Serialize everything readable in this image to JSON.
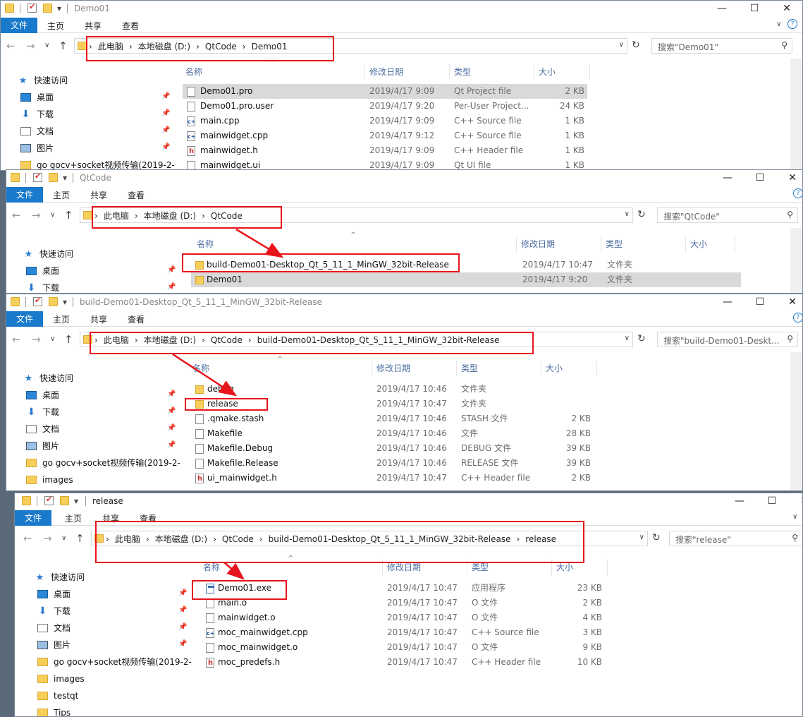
{
  "ribbon": {
    "file": "文件",
    "home": "主页",
    "share": "共享",
    "view": "查看",
    "help": "?"
  },
  "sidebar_common": {
    "quick_access": "快速访问",
    "desktop": "桌面",
    "downloads": "下载",
    "documents": "文档",
    "pictures": "图片",
    "gocv": "go gocv+socket视频传输(2019-2-",
    "images": "images",
    "testqt": "testqt",
    "tips": "Tips"
  },
  "columns": {
    "name": "名称",
    "date": "修改日期",
    "type": "类型",
    "size": "大小"
  },
  "windows": [
    {
      "title": "Demo01",
      "breadcrumbs": [
        "此电脑",
        "本地磁盘 (D:)",
        "QtCode",
        "Demo01"
      ],
      "search": "搜索\"Demo01\"",
      "files": [
        {
          "name": "Demo01.pro",
          "date": "2019/4/17 9:09",
          "type": "Qt Project file",
          "size": "2 KB",
          "icon": "pro-file-icon"
        },
        {
          "name": "Demo01.pro.user",
          "date": "2019/4/17 9:20",
          "type": "Per-User Project...",
          "size": "24 KB",
          "icon": "user-file-icon"
        },
        {
          "name": "main.cpp",
          "date": "2019/4/17 9:09",
          "type": "C++ Source file",
          "size": "1 KB",
          "icon": "cpp-file-icon"
        },
        {
          "name": "mainwidget.cpp",
          "date": "2019/4/17 9:12",
          "type": "C++ Source file",
          "size": "1 KB",
          "icon": "cpp-file-icon"
        },
        {
          "name": "mainwidget.h",
          "date": "2019/4/17 9:09",
          "type": "C++ Header file",
          "size": "1 KB",
          "icon": "header-file-icon"
        },
        {
          "name": "mainwidget.ui",
          "date": "2019/4/17 9:09",
          "type": "Qt UI file",
          "size": "1 KB",
          "icon": "ui-file-icon"
        }
      ]
    },
    {
      "title": "QtCode",
      "breadcrumbs": [
        "此电脑",
        "本地磁盘 (D:)",
        "QtCode"
      ],
      "search": "搜索\"QtCode\"",
      "files": [
        {
          "name": "build-Demo01-Desktop_Qt_5_11_1_MinGW_32bit-Release",
          "date": "2019/4/17 10:47",
          "type": "文件夹",
          "size": "",
          "icon": "folder-icon"
        },
        {
          "name": "Demo01",
          "date": "2019/4/17 9:20",
          "type": "文件夹",
          "size": "",
          "icon": "folder-icon"
        }
      ]
    },
    {
      "title": "build-Demo01-Desktop_Qt_5_11_1_MinGW_32bit-Release",
      "breadcrumbs": [
        "此电脑",
        "本地磁盘 (D:)",
        "QtCode",
        "build-Demo01-Desktop_Qt_5_11_1_MinGW_32bit-Release"
      ],
      "search": "搜索\"build-Demo01-Deskt...",
      "files": [
        {
          "name": "debug",
          "date": "2019/4/17 10:46",
          "type": "文件夹",
          "size": "",
          "icon": "folder-icon"
        },
        {
          "name": "release",
          "date": "2019/4/17 10:47",
          "type": "文件夹",
          "size": "",
          "icon": "folder-icon"
        },
        {
          "name": ".qmake.stash",
          "date": "2019/4/17 10:46",
          "type": "STASH 文件",
          "size": "2 KB",
          "icon": "file-icon"
        },
        {
          "name": "Makefile",
          "date": "2019/4/17 10:46",
          "type": "文件",
          "size": "28 KB",
          "icon": "file-icon"
        },
        {
          "name": "Makefile.Debug",
          "date": "2019/4/17 10:46",
          "type": "DEBUG 文件",
          "size": "39 KB",
          "icon": "file-icon"
        },
        {
          "name": "Makefile.Release",
          "date": "2019/4/17 10:46",
          "type": "RELEASE 文件",
          "size": "39 KB",
          "icon": "file-icon"
        },
        {
          "name": "ui_mainwidget.h",
          "date": "2019/4/17 10:47",
          "type": "C++ Header file",
          "size": "2 KB",
          "icon": "header-file-icon"
        }
      ]
    },
    {
      "title": "release",
      "breadcrumbs": [
        "此电脑",
        "本地磁盘 (D:)",
        "QtCode",
        "build-Demo01-Desktop_Qt_5_11_1_MinGW_32bit-Release",
        "release"
      ],
      "search": "搜索\"release\"",
      "files": [
        {
          "name": "Demo01.exe",
          "date": "2019/4/17 10:47",
          "type": "应用程序",
          "size": "23 KB",
          "icon": "exe-file-icon"
        },
        {
          "name": "main.o",
          "date": "2019/4/17 10:47",
          "type": "O 文件",
          "size": "2 KB",
          "icon": "file-icon"
        },
        {
          "name": "mainwidget.o",
          "date": "2019/4/17 10:47",
          "type": "O 文件",
          "size": "4 KB",
          "icon": "file-icon"
        },
        {
          "name": "moc_mainwidget.cpp",
          "date": "2019/4/17 10:47",
          "type": "C++ Source file",
          "size": "3 KB",
          "icon": "cpp-file-icon"
        },
        {
          "name": "moc_mainwidget.o",
          "date": "2019/4/17 10:47",
          "type": "O 文件",
          "size": "9 KB",
          "icon": "file-icon"
        },
        {
          "name": "moc_predefs.h",
          "date": "2019/4/17 10:47",
          "type": "C++ Header file",
          "size": "10 KB",
          "icon": "header-file-icon"
        }
      ]
    }
  ],
  "colors": {
    "accent": "#1979ca",
    "annotation_red": "#e8141c",
    "folder": "#f6cf5a"
  }
}
